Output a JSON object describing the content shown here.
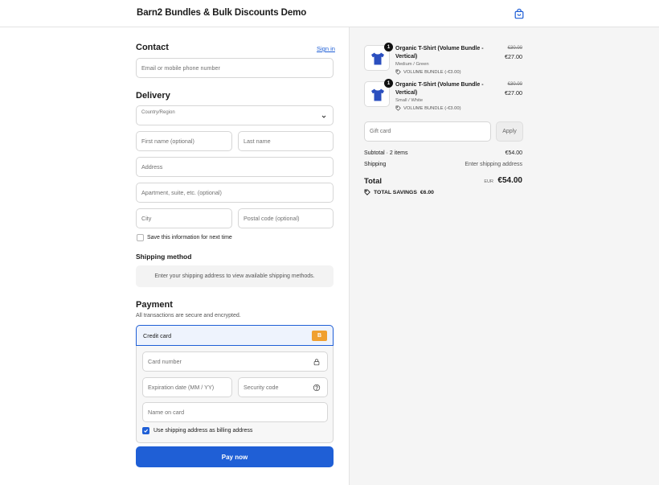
{
  "header": {
    "store_title": "Barn2 Bundles & Bulk Discounts Demo",
    "cart_icon": "shopping-bag-icon"
  },
  "contact": {
    "heading": "Contact",
    "sign_in_label": "Sign in",
    "email_placeholder": "Email or mobile phone number"
  },
  "delivery": {
    "heading": "Delivery",
    "country_label": "Country/Region",
    "first_name": "First name (optional)",
    "last_name": "Last name",
    "address": "Address",
    "apartment": "Apartment, suite, etc. (optional)",
    "city": "City",
    "postal": "Postal code (optional)",
    "save_info_label": "Save this information for next time",
    "save_info_checked": false
  },
  "shipping": {
    "heading": "Shipping method",
    "notice": "Enter your shipping address to view available shipping methods."
  },
  "payment": {
    "heading": "Payment",
    "subtitle": "All transactions are secure and encrypted.",
    "method_label": "Credit card",
    "method_badge": "B",
    "card_number": "Card number",
    "expiry": "Expiration date (MM / YY)",
    "security": "Security code",
    "name_on_card": "Name on card",
    "billing_same_label": "Use shipping address as billing address",
    "billing_same_checked": true,
    "pay_label": "Pay now",
    "accent": "#1f5fd6",
    "badge_color": "#f0a030"
  },
  "order": {
    "items": [
      {
        "qty": "1",
        "name_line1": "Organic T-Shirt (Volume Bundle -",
        "name_line2": "Vertical)",
        "variant": "Medium / Green",
        "discount": "VOLUME BUNDLE (-€3.00)",
        "price_old": "€30.00",
        "price_new": "€27.00"
      },
      {
        "qty": "1",
        "name_line1": "Organic T-Shirt (Volume Bundle -",
        "name_line2": "Vertical)",
        "variant": "Small / White",
        "discount": "VOLUME BUNDLE (-€3.00)",
        "price_old": "€30.00",
        "price_new": "€27.00"
      }
    ],
    "gift_card_placeholder": "Gift card",
    "apply_label": "Apply",
    "subtotal_label": "Subtotal · 2 items",
    "subtotal_value": "€54.00",
    "shipping_label": "Shipping",
    "shipping_value": "Enter shipping address",
    "total_label": "Total",
    "currency": "EUR",
    "total_value": "€54.00",
    "savings_label": "TOTAL SAVINGS",
    "savings_value": "€6.00"
  }
}
